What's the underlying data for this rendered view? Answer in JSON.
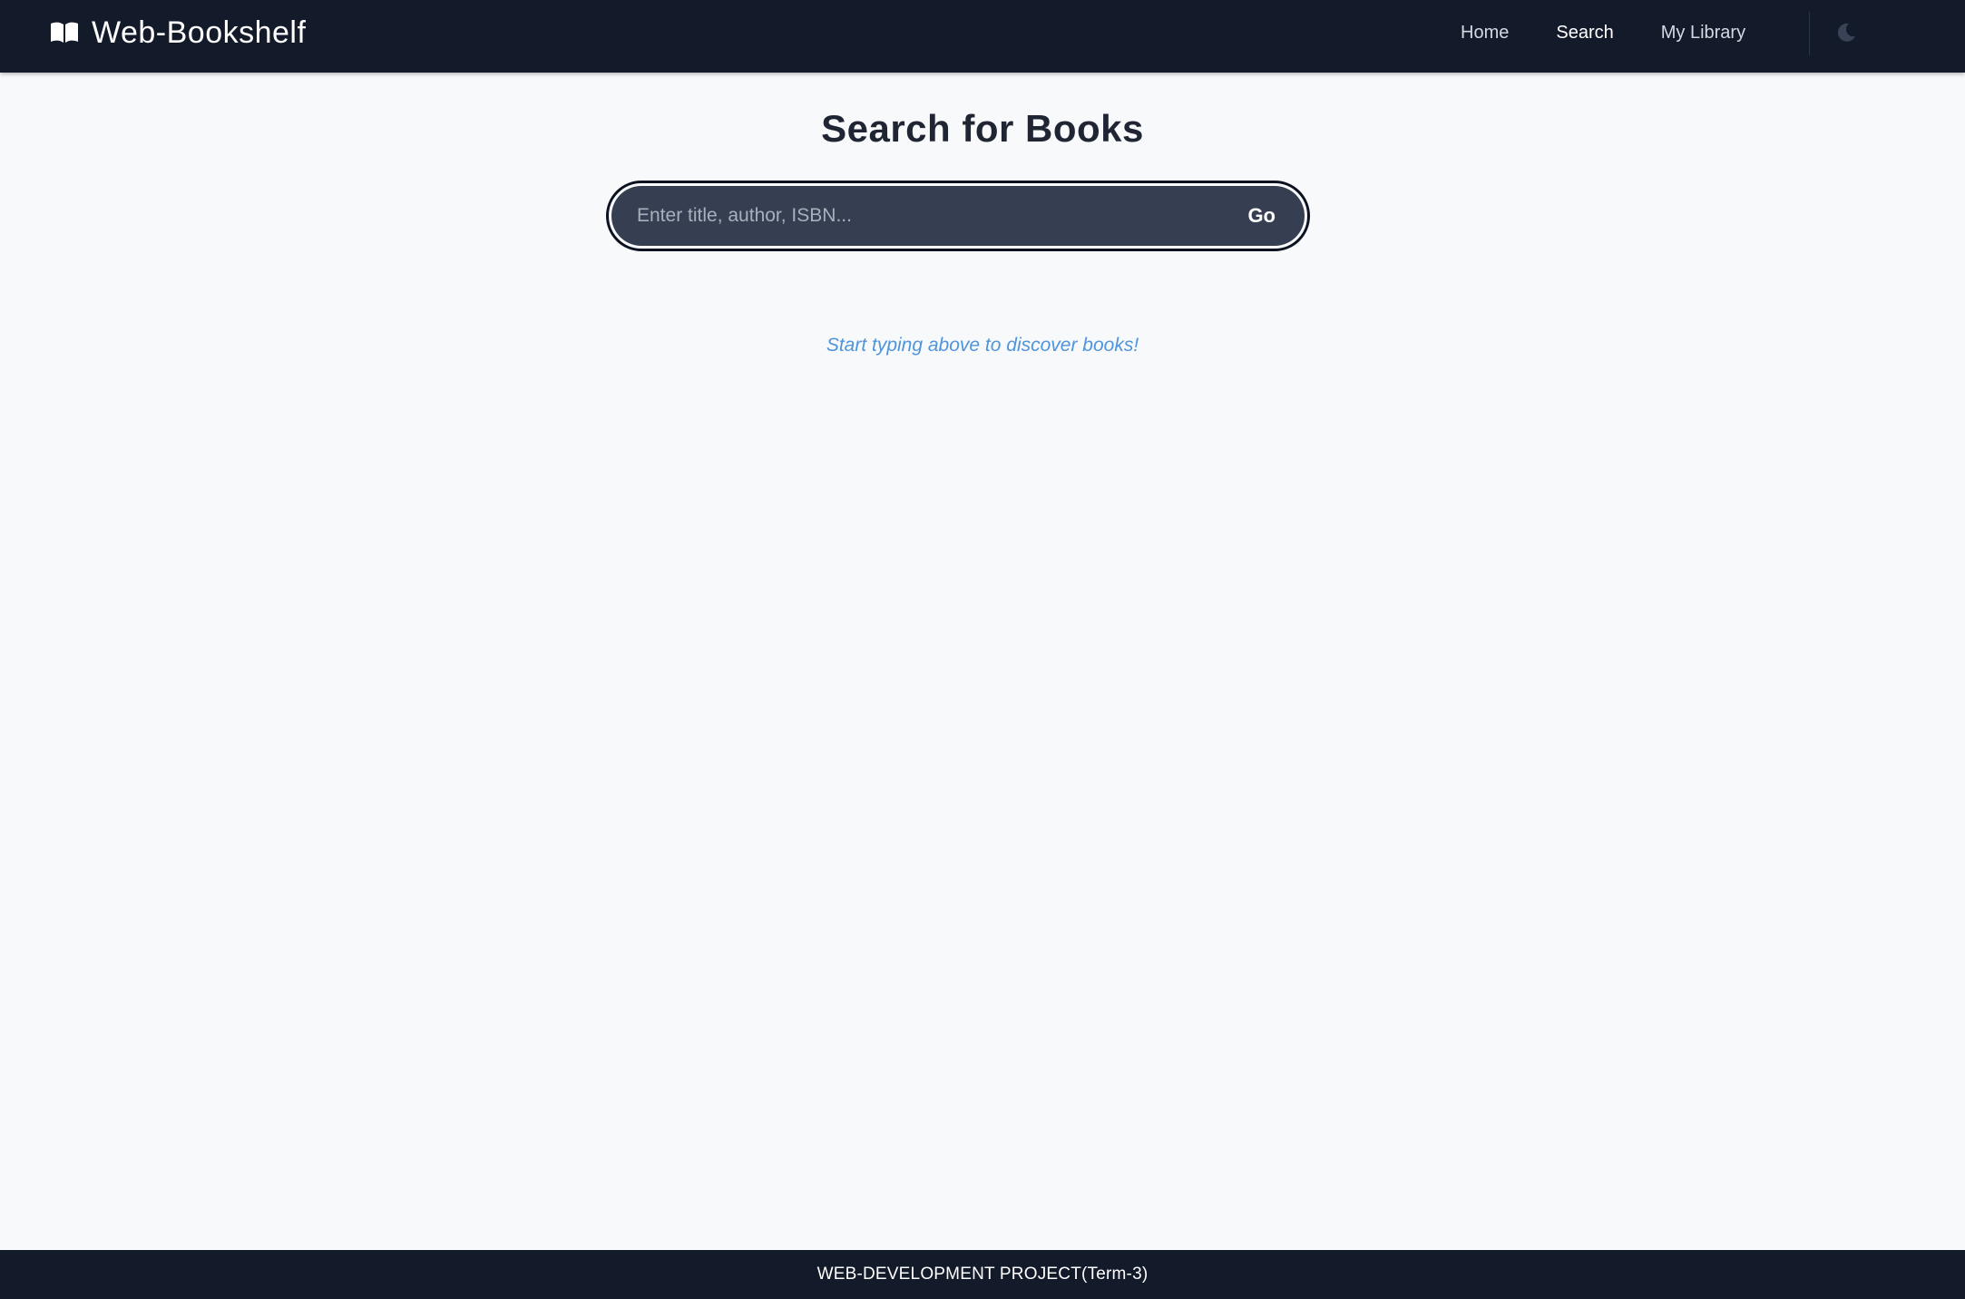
{
  "navbar": {
    "brand_icon": "open-book-icon",
    "brand_text": "Web-Bookshelf",
    "links": [
      {
        "label": "Home",
        "active": false
      },
      {
        "label": "Search",
        "active": true
      },
      {
        "label": "My Library",
        "active": false
      }
    ],
    "theme_toggle_icon": "moon-icon"
  },
  "main": {
    "title": "Search for Books",
    "search": {
      "placeholder": "Enter title, author, ISBN...",
      "value": "",
      "button_label": "Go"
    },
    "hint": "Start typing above to discover books!"
  },
  "footer": {
    "text": "WEB-DEVELOPMENT PROJECT(Term-3)"
  },
  "colors": {
    "navbar_bg": "#131a2a",
    "page_bg": "#f8f9fb",
    "search_bg": "#363f52",
    "hint": "#4f94dc",
    "title": "#1f2533"
  }
}
